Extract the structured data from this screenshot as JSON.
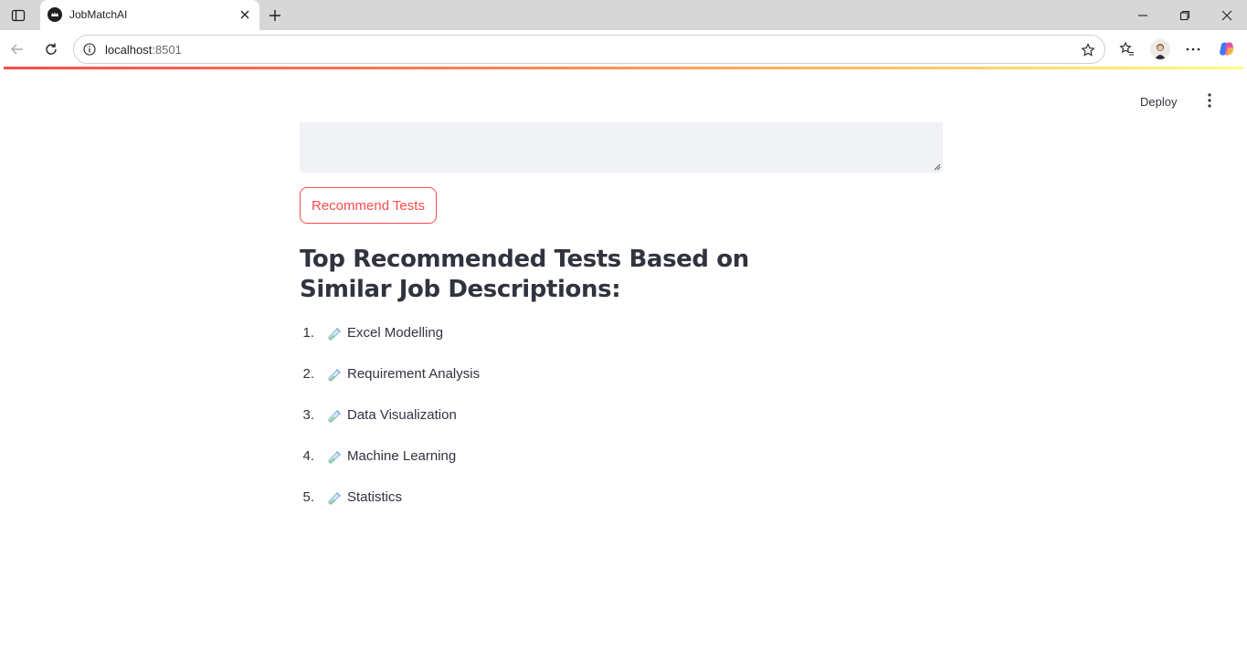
{
  "browser": {
    "tab_title": "JobMatchAI",
    "url_host": "localhost",
    "url_port": ":8501"
  },
  "app": {
    "deploy_label": "Deploy",
    "recommend_button_label": "Recommend Tests",
    "results_heading": "Top Recommended Tests Based on Similar Job Descriptions:",
    "tests": [
      {
        "num": "1.",
        "name": "Excel Modelling",
        "icon": "test-tube-icon"
      },
      {
        "num": "2.",
        "name": "Requirement Analysis",
        "icon": "test-tube-icon"
      },
      {
        "num": "3.",
        "name": "Data Visualization",
        "icon": "test-tube-icon"
      },
      {
        "num": "4.",
        "name": "Machine Learning",
        "icon": "test-tube-icon"
      },
      {
        "num": "5.",
        "name": "Statistics",
        "icon": "test-tube-icon"
      }
    ]
  },
  "colors": {
    "accent": "#ff4b4b",
    "text": "#31333f",
    "input_bg": "#f0f2f6"
  }
}
